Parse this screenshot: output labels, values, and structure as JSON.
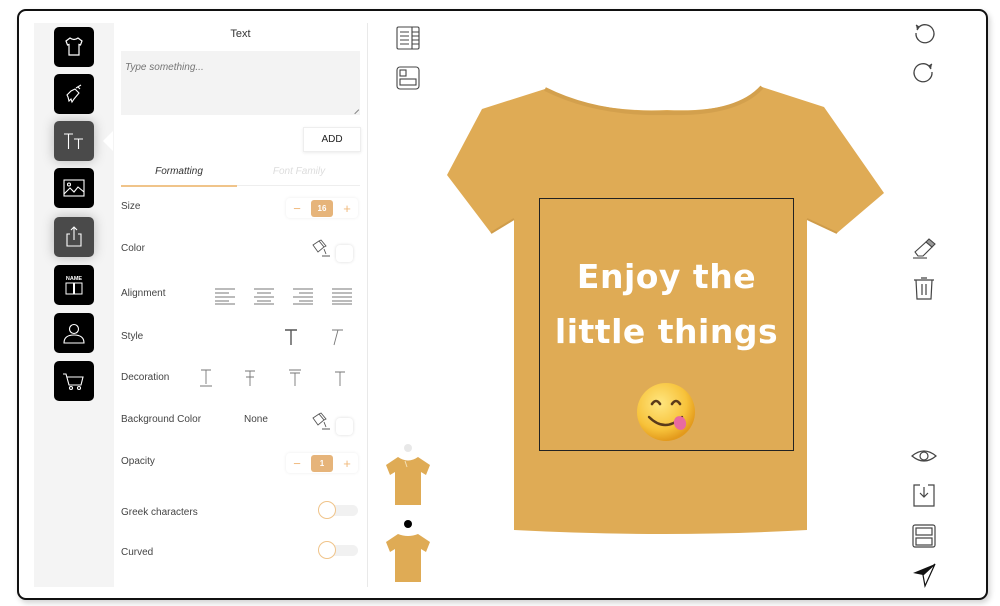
{
  "sidebar": {
    "items": [
      {
        "name": "product",
        "icon": "tshirt-icon",
        "active": false
      },
      {
        "name": "design",
        "icon": "paintbrush-icon",
        "active": false
      },
      {
        "name": "text",
        "icon": "text-icon",
        "active": true
      },
      {
        "name": "image",
        "icon": "image-icon",
        "active": false
      },
      {
        "name": "upload",
        "icon": "upload-icon",
        "active": false
      },
      {
        "name": "name-number",
        "icon": "name-number-icon",
        "label": "NAME",
        "active": false
      },
      {
        "name": "account",
        "icon": "user-icon",
        "active": false
      },
      {
        "name": "cart",
        "icon": "cart-icon",
        "active": false
      }
    ]
  },
  "panel": {
    "title": "Text",
    "input_placeholder": "Type something...",
    "input_value": "",
    "add_label": "ADD",
    "tabs": [
      {
        "label": "Formatting",
        "active": true
      },
      {
        "label": "Font Family",
        "active": false
      }
    ],
    "size": {
      "label": "Size",
      "value": "16",
      "minus": "−",
      "plus": "+"
    },
    "color": {
      "label": "Color",
      "value": "#ffffff"
    },
    "alignment": {
      "label": "Alignment",
      "options": [
        "left",
        "center",
        "right",
        "justify"
      ]
    },
    "style": {
      "label": "Style",
      "options": [
        "normal",
        "italic"
      ]
    },
    "decoration": {
      "label": "Decoration",
      "options": [
        "underline",
        "strikethrough",
        "overline",
        "none"
      ]
    },
    "background_color": {
      "label": "Background Color",
      "value": "None"
    },
    "opacity": {
      "label": "Opacity",
      "value": "1",
      "minus": "−",
      "plus": "+"
    },
    "greek": {
      "label": "Greek characters",
      "on": false
    },
    "curved": {
      "label": "Curved",
      "on": false
    }
  },
  "canvas": {
    "shirt_color": "#dfab55",
    "print_text_line1": "Enjoy the",
    "print_text_line2": "little things",
    "emoji": "smiling-face-savoring-food",
    "views": [
      {
        "name": "front",
        "selected": false
      },
      {
        "name": "back",
        "selected": true
      }
    ]
  },
  "toolbar_left": [
    "layers-icon",
    "template-icon"
  ],
  "toolbar_right_top": [
    "undo-icon",
    "redo-icon"
  ],
  "toolbar_right_mid": [
    "eraser-icon",
    "trash-icon"
  ],
  "toolbar_right_bottom": [
    "preview-icon",
    "download-icon",
    "save-icon",
    "send-icon"
  ],
  "colors": {
    "accent": "#e6b47a",
    "rail_bg": "#f4f4f4",
    "icon_bg": "#000000"
  }
}
